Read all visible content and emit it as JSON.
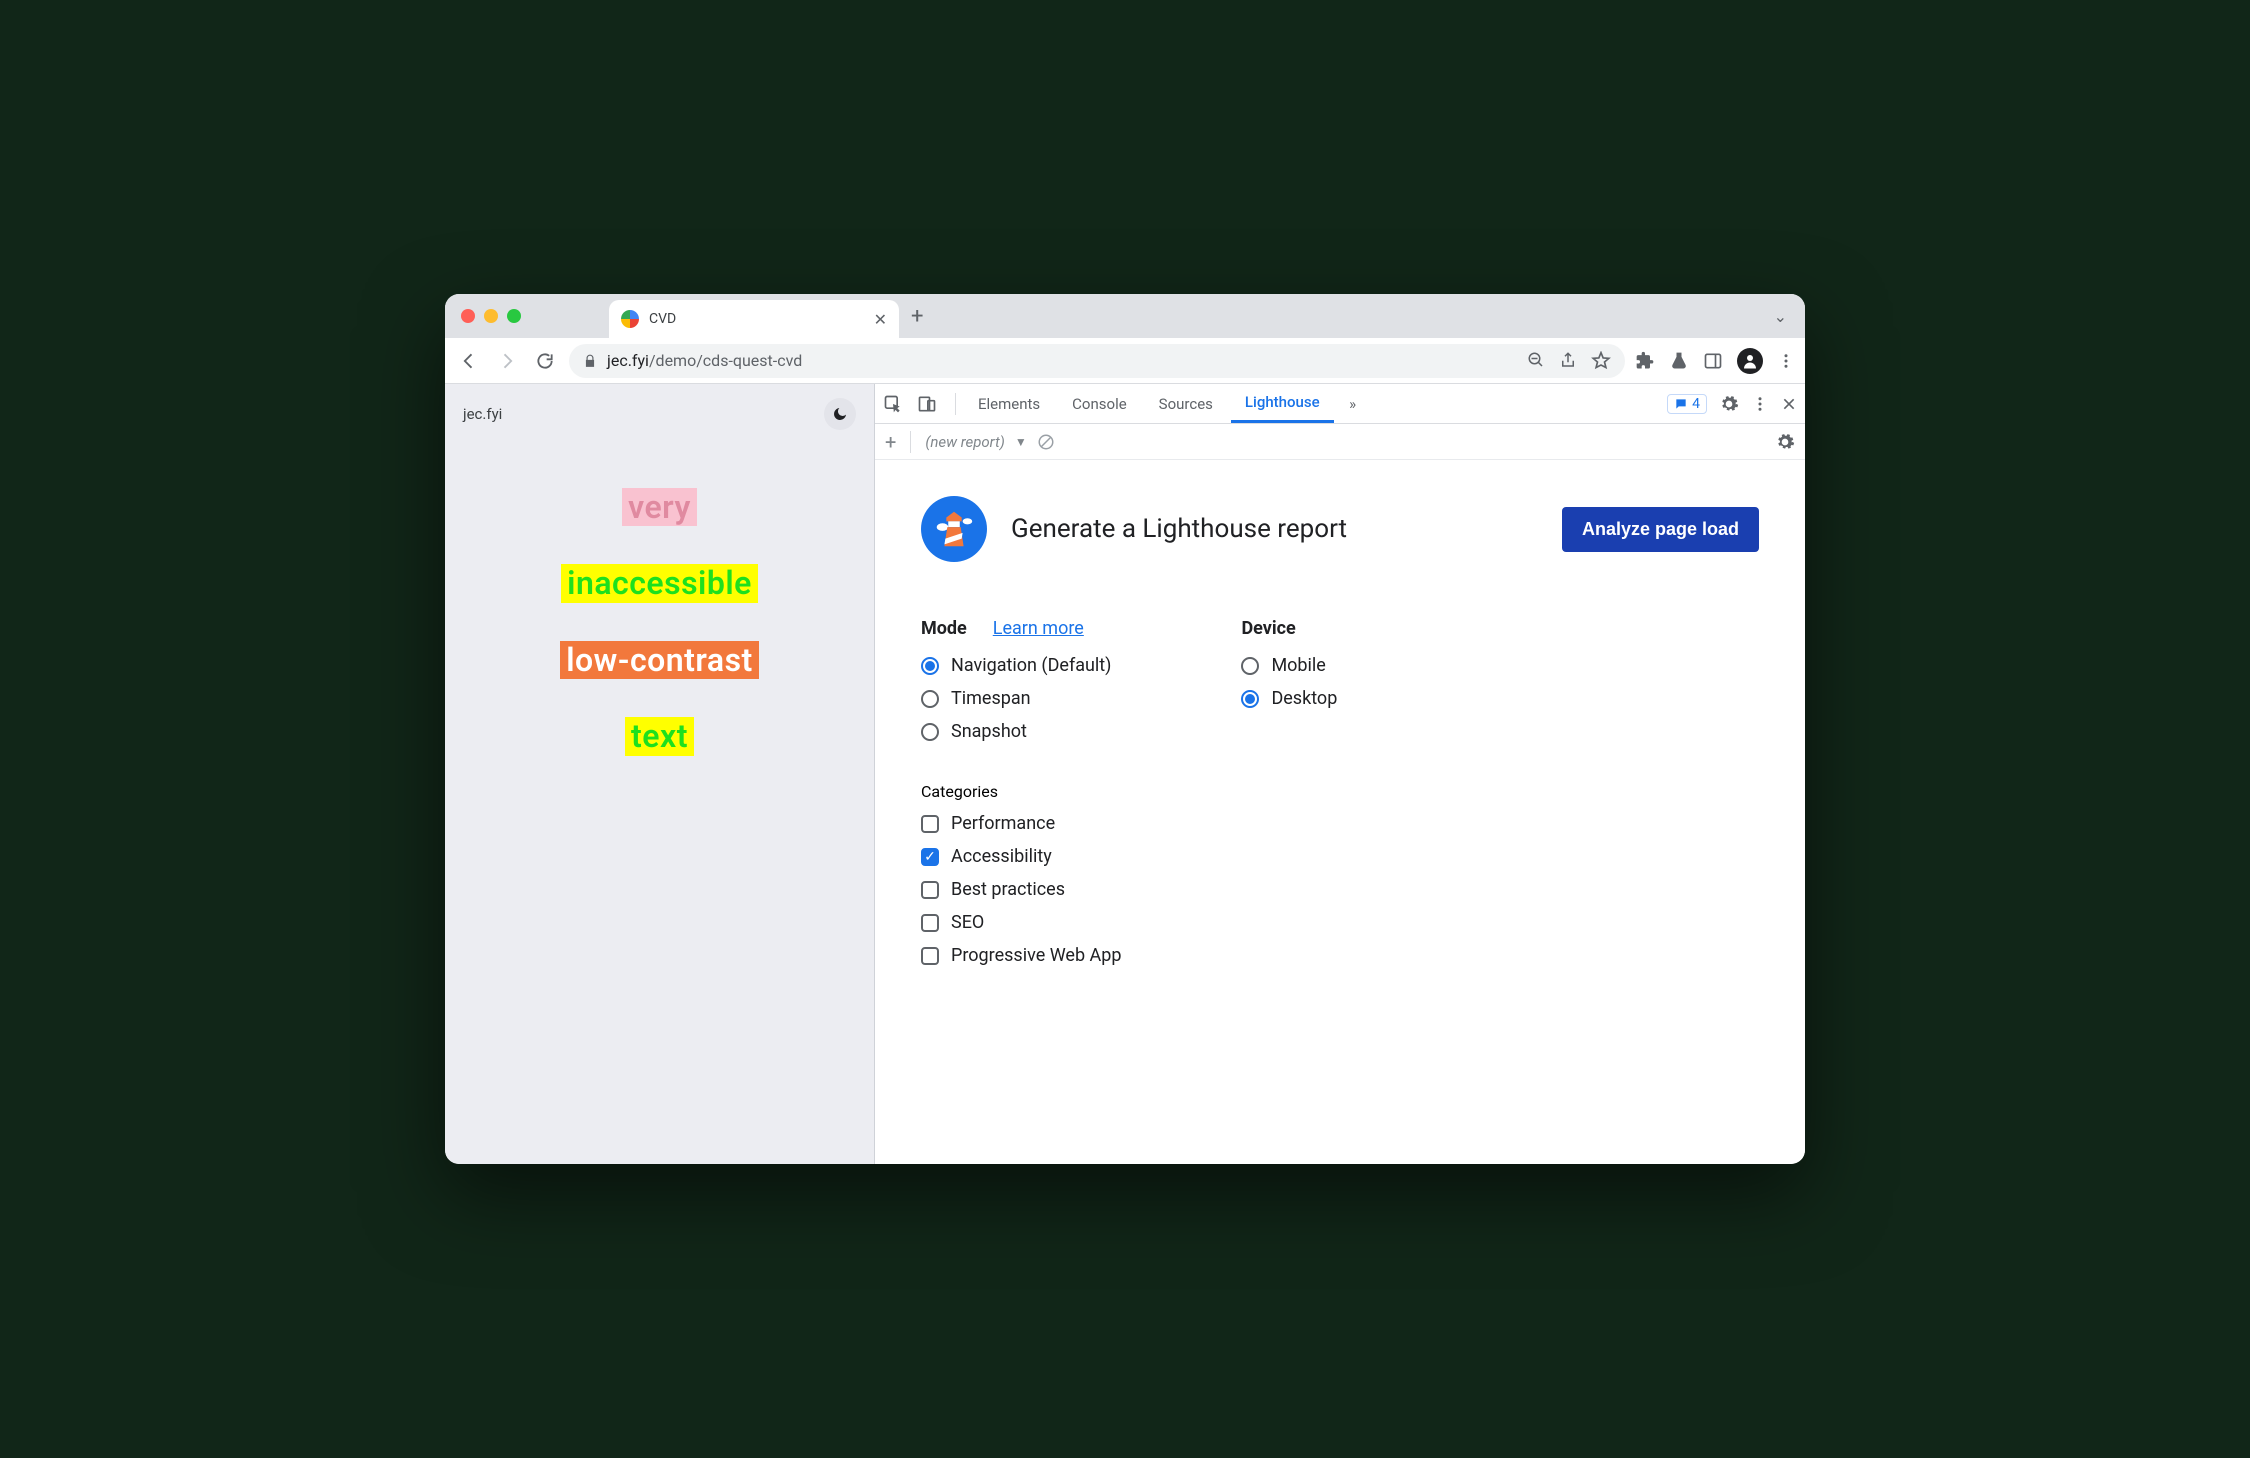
{
  "browser": {
    "tab_title": "CVD",
    "url_host": "jec.fyi",
    "url_path": "/demo/cds-quest-cvd"
  },
  "page": {
    "site_label": "jec.fyi",
    "samples": [
      "very",
      "inaccessible",
      "low-contrast",
      "text"
    ]
  },
  "devtools": {
    "tabs": [
      "Elements",
      "Console",
      "Sources",
      "Lighthouse"
    ],
    "active_tab": "Lighthouse",
    "issues_count": "4",
    "report_selector": "(new report)"
  },
  "lighthouse": {
    "title": "Generate a Lighthouse report",
    "analyze_button": "Analyze page load",
    "mode_label": "Mode",
    "learn_more": "Learn more",
    "modes": [
      {
        "label": "Navigation (Default)",
        "selected": true
      },
      {
        "label": "Timespan",
        "selected": false
      },
      {
        "label": "Snapshot",
        "selected": false
      }
    ],
    "device_label": "Device",
    "devices": [
      {
        "label": "Mobile",
        "selected": false
      },
      {
        "label": "Desktop",
        "selected": true
      }
    ],
    "categories_label": "Categories",
    "categories": [
      {
        "label": "Performance",
        "checked": false
      },
      {
        "label": "Accessibility",
        "checked": true
      },
      {
        "label": "Best practices",
        "checked": false
      },
      {
        "label": "SEO",
        "checked": false
      },
      {
        "label": "Progressive Web App",
        "checked": false
      }
    ]
  }
}
